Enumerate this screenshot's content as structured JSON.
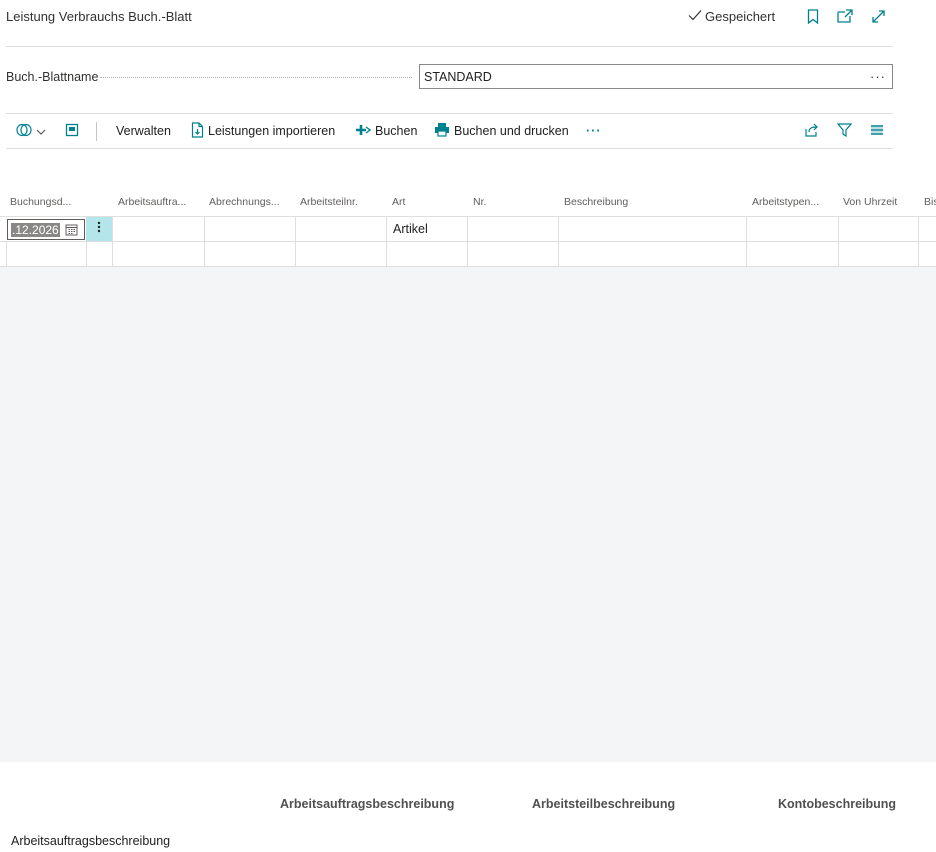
{
  "header": {
    "title": "Leistung Verbrauchs Buch.-Blatt",
    "status": "Gespeichert"
  },
  "field": {
    "label": "Buch.-Blattname",
    "value": "STANDARD",
    "more": "···"
  },
  "toolbar": {
    "manage": "Verwalten",
    "import": "Leistungen importieren",
    "post": "Buchen",
    "post_print": "Buchen und drucken",
    "more": "···"
  },
  "grid": {
    "columns": [
      "Buchungsd...",
      "Arbeitsauftra...",
      "Abrechnungs...",
      "Arbeitsteilnr.",
      "Art",
      "Nr.",
      "Beschreibung",
      "Arbeitstypen...",
      "Von Uhrzeit",
      "Bis"
    ],
    "rows": [
      {
        "date": ".12.2026",
        "art": "Artikel"
      }
    ]
  },
  "footer": {
    "labels": [
      "Arbeitsauftragsbeschreibung",
      "Arbeitsteilbeschreibung",
      "Kontobeschreibung"
    ],
    "value": "Arbeitsauftragsbeschreibung"
  },
  "colors": {
    "accent": "#00818f",
    "selected_row_handle": "#b4e5ea",
    "gray_area": "#f4f5f6"
  }
}
